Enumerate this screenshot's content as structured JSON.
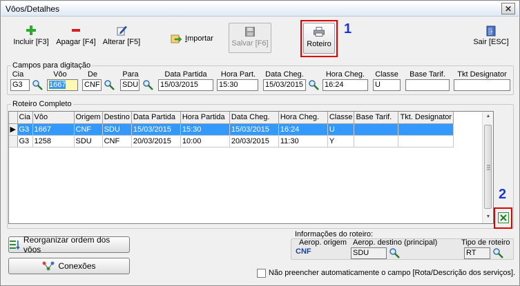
{
  "window": {
    "title": "Vôos/Detalhes",
    "close_glyph": "✕"
  },
  "toolbar": {
    "include_label": "Incluir [F3]",
    "delete_label": "Apagar [F4]",
    "edit_label": "Alterar [F5]",
    "import_label": "Importar",
    "import_mnemonic": "I",
    "import_rest": "mportar",
    "save_label": "Salvar [F6]",
    "route_label": "Roteiro",
    "exit_label": "Sair [ESC]"
  },
  "annotations": {
    "marker1": "1",
    "marker2": "2",
    "accent": "#e00000",
    "marker_color": "#1c33d8"
  },
  "entry": {
    "legend": "Campos para digitação",
    "fields": {
      "cia": {
        "label": "Cia",
        "value": "G3"
      },
      "voo": {
        "label": "Vôo",
        "value": "1667"
      },
      "de": {
        "label": "De",
        "value": "CNF"
      },
      "para": {
        "label": "Para",
        "value": "SDU"
      },
      "data_partida": {
        "label": "Data Partida",
        "value": "15/03/2015"
      },
      "hora_part": {
        "label": "Hora Part.",
        "value": "15:30"
      },
      "data_cheg": {
        "label": "Data Cheg.",
        "value": "15/03/2015"
      },
      "hora_cheg": {
        "label": "Hora Cheg.",
        "value": "16:24"
      },
      "classe": {
        "label": "Classe",
        "value": "U"
      },
      "base_tarif": {
        "label": "Base Tarif.",
        "value": ""
      },
      "tkt_designator": {
        "label": "Tkt Designator",
        "value": ""
      }
    }
  },
  "roteiro": {
    "legend": "Roteiro Completo",
    "columns": [
      "Cia",
      "Vôo",
      "Origem",
      "Destino",
      "Data Partida",
      "Hora Partida",
      "Data Cheg.",
      "Hora Cheg.",
      "Classe",
      "Base Tarif.",
      "Tkt. Designator"
    ],
    "rows": [
      [
        "G3",
        "1667",
        "CNF",
        "SDU",
        "15/03/2015",
        "15:30",
        "15/03/2015",
        "16:24",
        "U",
        "",
        ""
      ],
      [
        "G3",
        "1258",
        "SDU",
        "CNF",
        "20/03/2015",
        "10:00",
        "20/03/2015",
        "11:30",
        "Y",
        "",
        ""
      ]
    ],
    "selected_row_color": "#3399ff"
  },
  "bottom": {
    "reorder_label": "Reorganizar ordem dos vôos",
    "connections_label": "Conexões",
    "info_title": "Informações do roteiro:",
    "aerop_origem_label": "Aerop. origem",
    "aerop_origem_value": "CNF",
    "aerop_destino_label": "Aerop. destino (principal)",
    "aerop_destino_value": "SDU",
    "tipo_roteiro_label": "Tipo de roteiro",
    "tipo_roteiro_value": "RT",
    "no_autofill_label": "Não preencher automaticamente o campo [Rota/Descrição dos serviços]."
  }
}
